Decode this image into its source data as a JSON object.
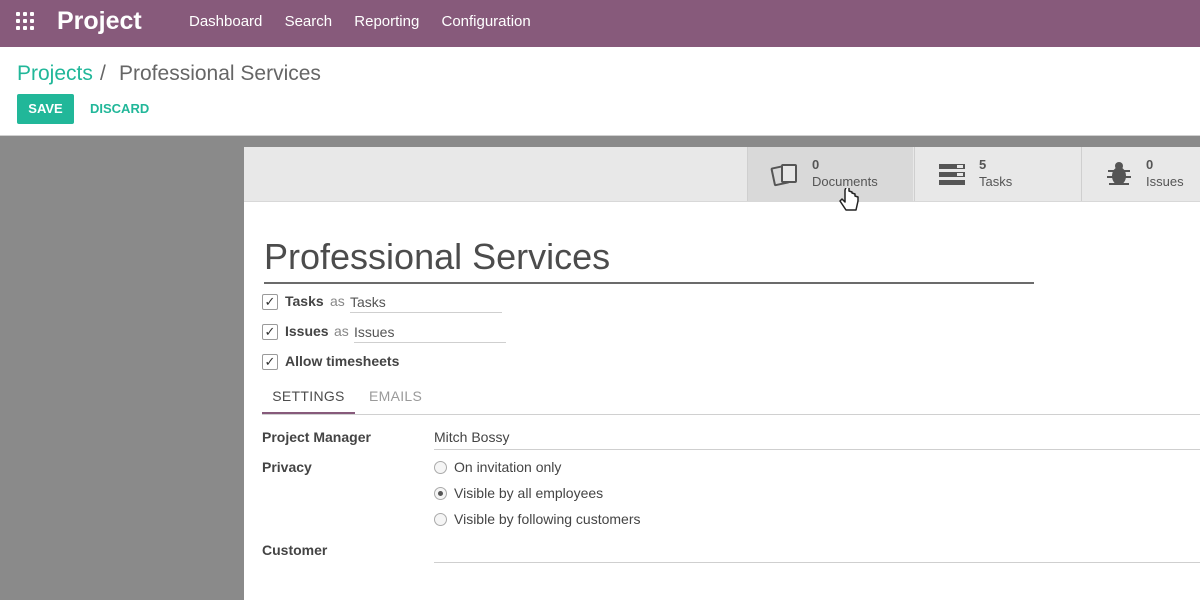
{
  "navbar": {
    "app_name": "Project",
    "menu": [
      "Dashboard",
      "Search",
      "Reporting",
      "Configuration"
    ],
    "background": "#875a7b"
  },
  "breadcrumb": {
    "parent": "Projects",
    "separator": "/",
    "current": "Professional Services"
  },
  "actions": {
    "save": "SAVE",
    "discard": "DISCARD",
    "accent": "#21b799"
  },
  "smart_buttons": [
    {
      "count": "0",
      "label": "Documents",
      "icon": "documents-icon"
    },
    {
      "count": "5",
      "label": "Tasks",
      "icon": "tasks-icon"
    },
    {
      "count": "0",
      "label": "Issues",
      "icon": "bug-icon"
    }
  ],
  "form": {
    "title": "Professional Services",
    "checkboxes": [
      {
        "label": "Tasks",
        "as": "as",
        "value": "Tasks",
        "checked": true
      },
      {
        "label": "Issues",
        "as": "as",
        "value": "Issues",
        "checked": true
      },
      {
        "label": "Allow timesheets",
        "checked": true
      }
    ],
    "tabs": [
      "SETTINGS",
      "EMAILS"
    ],
    "project_manager": {
      "label": "Project Manager",
      "value": "Mitch Bossy"
    },
    "privacy": {
      "label": "Privacy",
      "options": [
        "On invitation only",
        "Visible by all employees",
        "Visible by following customers"
      ],
      "selected": "Visible by all employees"
    },
    "customer": {
      "label": "Customer",
      "value": ""
    }
  }
}
